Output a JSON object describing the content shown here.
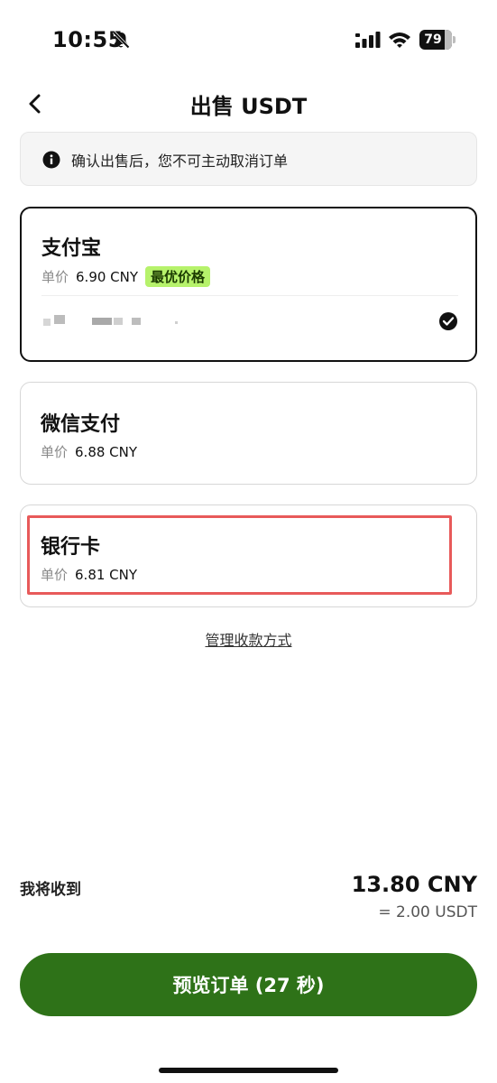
{
  "status_bar": {
    "time": "10:55",
    "battery": "79",
    "battery_level": 0.79
  },
  "header": {
    "title": "出售 USDT"
  },
  "notice": {
    "text": "确认出售后，您不可主动取消订单"
  },
  "payment_methods": [
    {
      "name": "支付宝",
      "price_label": "单价",
      "price": "6.90 CNY",
      "badge": "最优价格",
      "selected": true
    },
    {
      "name": "微信支付",
      "price_label": "单价",
      "price": "6.88 CNY"
    },
    {
      "name": "银行卡",
      "price_label": "单价",
      "price": "6.81 CNY"
    }
  ],
  "manage_link": "管理收款方式",
  "summary": {
    "receive_label": "我将收到",
    "receive_amount": "13.80 CNY",
    "receive_usdt": "= 2.00 USDT"
  },
  "preview_button": "预览订单 (27 秒)",
  "colors": {
    "primary_button": "#2e7218",
    "badge": "#b6f26b",
    "highlight": "#e85a5a"
  }
}
